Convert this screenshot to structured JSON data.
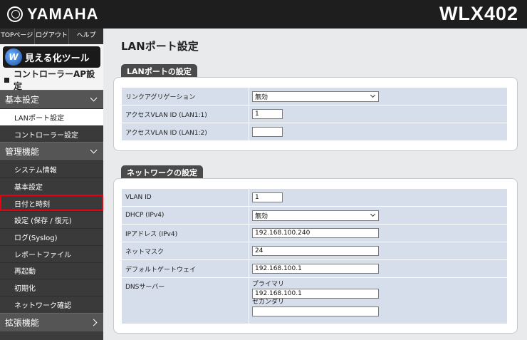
{
  "header": {
    "brand": "YAMAHA",
    "model": "WLX402"
  },
  "topnav": [
    "TOPページ",
    "ログアウト",
    "ヘルプ"
  ],
  "viz_button": "見える化ツール",
  "viz_icon_letter": "W",
  "section_title": "コントローラーAP設定",
  "sidebar": {
    "group_basic": "基本設定",
    "basic_items": [
      "LANポート設定",
      "コントローラー設定"
    ],
    "group_admin": "管理機能",
    "admin_items": [
      "システム情報",
      "基本設定",
      "日付と時刻",
      "設定 (保存 / 復元)",
      "ログ(Syslog)",
      "レポートファイル",
      "再起動",
      "初期化",
      "ネットワーク確認"
    ],
    "group_ext": "拡張機能"
  },
  "main": {
    "title": "LANポート設定",
    "lan_panel": {
      "tab": "LANポートの設定",
      "rows": [
        {
          "label": "リンクアグリゲーション",
          "value": "無効"
        },
        {
          "label": "アクセスVLAN ID (LAN1:1)",
          "value": "1"
        },
        {
          "label": "アクセスVLAN ID (LAN1:2)",
          "value": ""
        }
      ]
    },
    "net_panel": {
      "tab": "ネットワークの設定",
      "rows": [
        {
          "label": "VLAN ID",
          "value": "1"
        },
        {
          "label": "DHCP (IPv4)",
          "value": "無効"
        },
        {
          "label": "IPアドレス (IPv4)",
          "value": "192.168.100.240"
        },
        {
          "label": "ネットマスク",
          "value": "24"
        },
        {
          "label": "デフォルトゲートウェイ",
          "value": "192.168.100.1"
        },
        {
          "label": "DNSサーバー",
          "primary_label": "プライマリ",
          "primary": "192.168.100.1",
          "secondary_label": "セカンダリ",
          "secondary": ""
        }
      ]
    }
  },
  "colors": {
    "highlight": "#e60012",
    "header_bg": "#1e1e1e",
    "row_bg": "#d5deea"
  }
}
